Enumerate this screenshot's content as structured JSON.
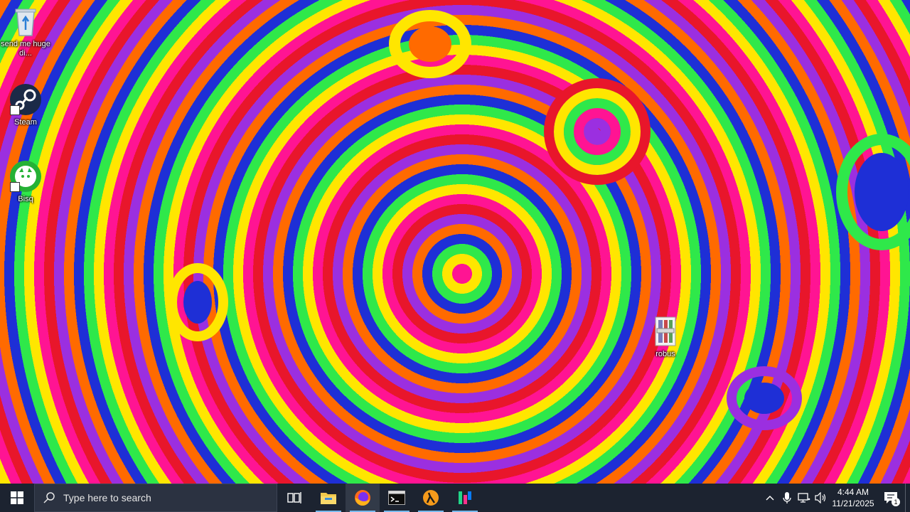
{
  "desktop": {
    "icons": [
      {
        "name": "recycle-bin",
        "label": "send me huge di..."
      },
      {
        "name": "steam",
        "label": "Steam"
      },
      {
        "name": "bisq",
        "label": "Bisq"
      },
      {
        "name": "robus",
        "label": "robus"
      }
    ]
  },
  "taskbar": {
    "search": {
      "placeholder": "Type here to search"
    },
    "apps": [
      {
        "name": "start-icon"
      },
      {
        "name": "task-view-icon"
      },
      {
        "name": "file-explorer-icon"
      },
      {
        "name": "firefox-icon",
        "active": true
      },
      {
        "name": "terminal-icon"
      },
      {
        "name": "half-life-icon"
      },
      {
        "name": "jetbrains-icon"
      }
    ],
    "tray": {
      "time": "4:44 AM",
      "date": "11/21/2025",
      "notification_count": "1"
    }
  },
  "colors": {
    "taskbar": "#1c2330",
    "accent": "#76b9ed"
  }
}
